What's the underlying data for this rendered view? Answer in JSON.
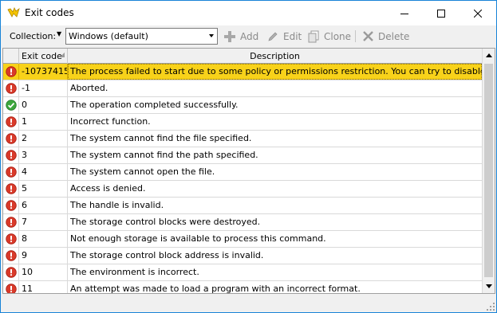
{
  "window": {
    "title": "Exit codes",
    "icon": "exit-codes-app-icon",
    "accent": "#1883d7"
  },
  "toolbar": {
    "collection_label": "Collection:",
    "collection_value": "Windows (default)",
    "add_label": "Add",
    "edit_label": "Edit",
    "clone_label": "Clone",
    "delete_label": "Delete"
  },
  "grid": {
    "columns": {
      "exit_code": "Exit code",
      "description": "Description"
    },
    "selection_color": "#f8d21a",
    "rows": [
      {
        "status": "error",
        "code": "-10737415",
        "description": "The process failed to start due to some policy or permissions restriction. You can try to disable UAC in",
        "selected": true
      },
      {
        "status": "error",
        "code": "-1",
        "description": "Aborted."
      },
      {
        "status": "success",
        "code": "0",
        "description": "The operation completed successfully."
      },
      {
        "status": "error",
        "code": "1",
        "description": "Incorrect function."
      },
      {
        "status": "error",
        "code": "2",
        "description": "The system cannot find the file specified."
      },
      {
        "status": "error",
        "code": "3",
        "description": "The system cannot find the path specified."
      },
      {
        "status": "error",
        "code": "4",
        "description": "The system cannot open the file."
      },
      {
        "status": "error",
        "code": "5",
        "description": "Access is denied."
      },
      {
        "status": "error",
        "code": "6",
        "description": "The handle is invalid."
      },
      {
        "status": "error",
        "code": "7",
        "description": "The storage control blocks were destroyed."
      },
      {
        "status": "error",
        "code": "8",
        "description": "Not enough storage is available to process this command."
      },
      {
        "status": "error",
        "code": "9",
        "description": "The storage control block address is invalid."
      },
      {
        "status": "error",
        "code": "10",
        "description": "The environment is incorrect."
      },
      {
        "status": "error",
        "code": "11",
        "description": "An attempt was made to load a program with an incorrect format."
      }
    ]
  }
}
